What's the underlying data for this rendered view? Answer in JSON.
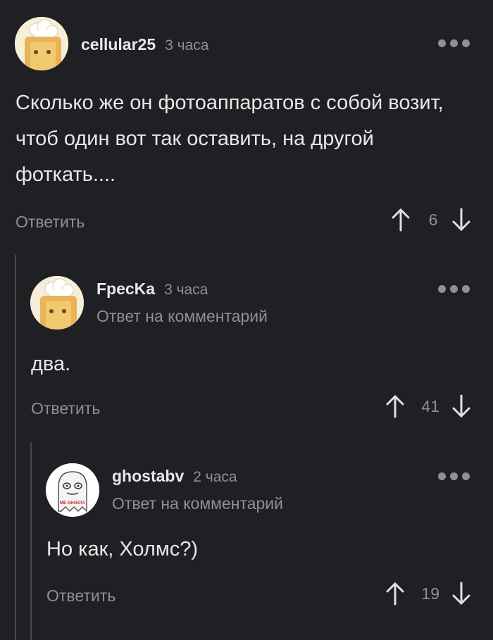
{
  "comments": [
    {
      "username": "cellular25",
      "time": "3 часа",
      "reply_to": "",
      "text": "Сколько же он фотоаппаратов с собой возит, чтоб один вот так оставить, на другой фоткать....",
      "reply_label": "Ответить",
      "rating": "6",
      "avatar": "chef-toast-avatar"
    },
    {
      "username": "FpecKa",
      "time": "3 часа",
      "reply_to": "Ответ на комментарий",
      "text": "два.",
      "reply_label": "Ответить",
      "rating": "41",
      "avatar": "chef-toast-avatar"
    },
    {
      "username": "ghostabv",
      "time": "2 часа",
      "reply_to": "Ответ на комментарий",
      "text": "Но как, Холмс?)",
      "reply_label": "Ответить",
      "rating": "19",
      "avatar": "me-ghosta-avatar",
      "avatar_caption": "ME GHOSTA"
    }
  ],
  "colors": {
    "background": "#1f2023",
    "text": "#e8e8e8",
    "muted": "#8f9095",
    "thread_line": "#45474c"
  }
}
